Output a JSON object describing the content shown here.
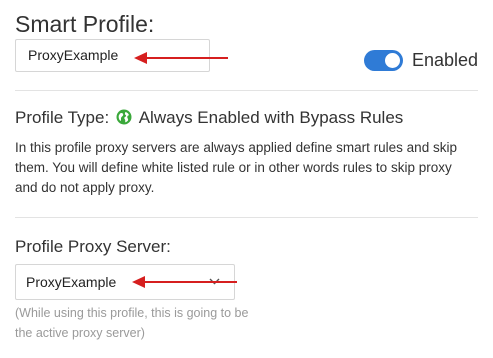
{
  "profile": {
    "heading": "Smart Profile:",
    "name_value": "ProxyExample",
    "enabled_label": "Enabled",
    "enabled": true
  },
  "profile_type": {
    "label": "Profile Type:",
    "icon": "globe-icon",
    "value": "Always Enabled with Bypass Rules",
    "description": "In this profile proxy servers are always applied define smart rules and skip them. You will define white listed rule or in other words rules to skip proxy and do not apply proxy."
  },
  "proxy_server": {
    "label": "Profile Proxy Server:",
    "selected": "ProxyExample",
    "hint": "(While using this profile, this is going to be the active proxy server)"
  },
  "colors": {
    "accent": "#2f7bd6",
    "arrow": "#d61f1f",
    "globe": "#3aa83a"
  }
}
